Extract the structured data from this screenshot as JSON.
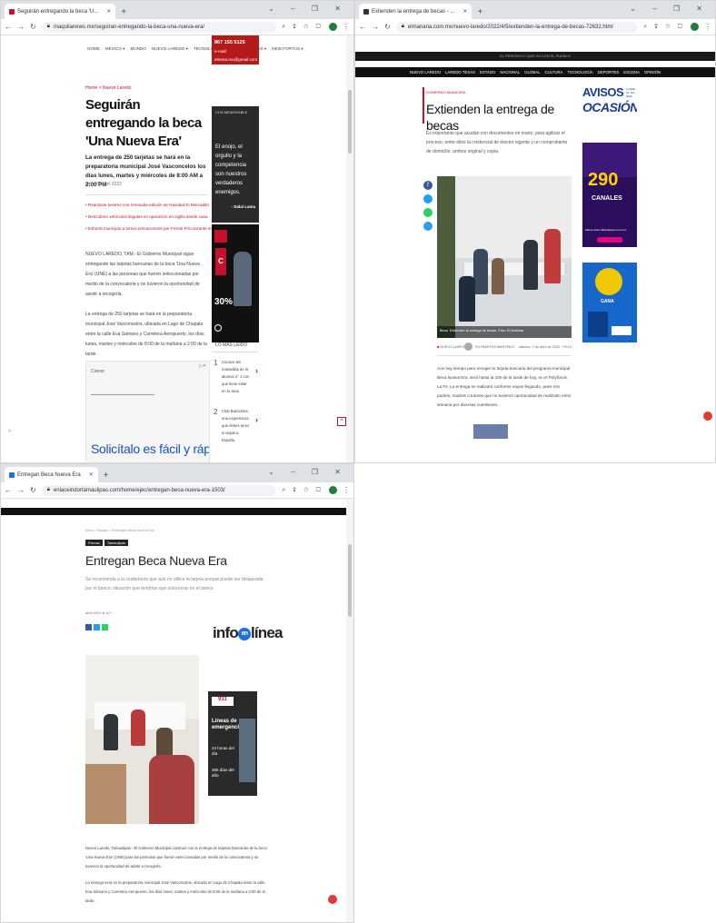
{
  "windows": {
    "w1": {
      "tab_title": "Seguirán entregando la beca 'U...",
      "url": "maquilanews.mx/seguiran-entregando-la-beca-una-nueva-era/",
      "nav_items": [
        "HOME",
        "MÉXICO ▾",
        "MUNDO",
        "NUEVO LAREDO ▾",
        "TECNOLOGÍA ▾",
        "ESPECTÁCULOS ▾",
        "NEW FORTUS ▾"
      ],
      "phone": "867 155 5125",
      "email": "e-mail: elmera.mx@gmail.com",
      "breadcrumb": "Home  >  Nuevo Laredo",
      "headline": "Seguirán entregando la beca 'Una Nueva Era'",
      "subhead": "La entrega de 250 tarjetas se hará en la preparatoria municipal José Vasconcelos los días lunes, martes y miércoles de 8:00 AM a 2:00 PM",
      "byline": "On  ·  25 abril 2022",
      "related": [
        "Reactivan turismo con renovada edición de Navidad El Mercadito",
        "Descubren vehículos ilegales en operación en vigilia desde casa",
        "Exhorta municipio a tomar precauciones por Frente Frío durante el fin de semana"
      ],
      "body1": "NUEVO LAREDO, TAM.- El Gobierno Municipal sigue entregando las tarjetas bancarias de la beca 'Una Nueva Era' (UNE) a las personas que fueron seleccionadas por medio de la convocatoria y no tuvieron la oportunidad de asistir a recogerla.",
      "body2": "La entrega de 250 tarjetas se hará en la preparatoria municipal José Vasconcelos, ubicada en Lago de Chapala entre la calle Eva Sámano y Carretera Aeropuerto, los días lunes, martes y miércoles de 8:00 de la mañana a 2:00 de la tarde.",
      "quote_label": "CITA MEMORABLE",
      "quote": "El enojo, el orgullo y la competencia son nuestros verdaderos enemigos.",
      "quote_author": "- Dalai Lama",
      "ad_percent": "30%",
      "most_read_label": "LO MÁS LEÍDO",
      "most_read": [
        {
          "num": "1",
          "text": "Conoce las maravillas de la alumna 4° 1 con que tiene estar en tu área"
        },
        {
          "num": "2",
          "text": "Club Barcelona, una experiencia que debes tener si viajas a España"
        }
      ],
      "ad_label": "Crecer",
      "ad_text": "Solicítalo es fácil y rápido"
    },
    "w2": {
      "tab_title": "Extienden la entrega de becas - ...",
      "url": "elmanana.com.mx/nuevo-laredo/2022/4/5/extienden-la-entrega-de-becas-72632.html",
      "top_strip": "EL PERIÓDICO QUE HA CON EL PUEBLO",
      "nav_items": [
        "NUEVO LAREDO",
        "LAREDO TEXAS",
        "ESTADO",
        "NACIONAL",
        "GLOBAL",
        "CULTURA",
        "TECNOLOGÍA",
        "DEPORTES",
        "ESCENA",
        "OPINIÓN"
      ],
      "kicker": "GOBIERNO MUNICIPAL",
      "headline": "Extienden la entrega de becas",
      "subhead": "Es importante que acudan con documentos en mano, para agilizar el proceso, entre ellos la credencial de elector vigente y un comprobante de domicilio, ambos original y copia.",
      "caption": "Beca. Extienden la entrega de becas. Foto: El Mañana",
      "section": "NUEVO LAREDO",
      "author": "Por MARTHA MARTÍNEZ",
      "date": "sábado, 2 de abril de 2022 · 09:10",
      "body": "Aún hay tiempo para recoger tu tarjeta bancaria del programa municipal Beca Nueva Era, será hasta la 100 de la tarde de hoy, en el Polyforum La Fe. La entrega se realizará conforme vayan llegando, pues son padres, madres o tutores que no tuvieron oportunidad de realizarlo entre semana por diversas cuestiones.",
      "avisos_line1": "AVISOS",
      "avisos_line2": "OCASIÓN",
      "avisos_side": "LLAME AL 711-9000",
      "ad1_big": "290",
      "ad1_label": "CANALES",
      "ad1_url": "Marca www.cablecalepco.com.mx",
      "ad2_label": "GANA"
    },
    "w3": {
      "tab_title": "Entregan Beca Nueva Era",
      "url": "enlaceindortamaulipas.com/home/ejec/entregan-beca-nueva-era-1503/",
      "breadcrumb": "Inicio  ›  Estado  ›  Entregan Beca Nueva Era",
      "tags": [
        "Prensa",
        "Tamaulipas"
      ],
      "headline": "Entregan Beca Nueva Era",
      "subhead": "Se recomienda a la ciudadanía que aún no utilice la tarjeta porque puede ser bloqueada por el banco; situación que tendrían que solucionar en el banco",
      "meta": "abril 2022   ● 127",
      "logo_text1": "info",
      "logo_text2": "en",
      "logo_text3": "línea",
      "ad_title": "Líneas de emergencia",
      "ad_lines": [
        "24 horas del día",
        "365 días del año"
      ],
      "body1": "Nuevo Laredo, Tamaulipas.- El Gobierno Municipal continuó con la entrega de tarjetas bancarias de la beca 'Una Nueva Era' (UNE) para las personas que fueron seleccionadas por medio de la convocatoria y no tuvieron la oportunidad de asistir a recogerla.",
      "body2": "La entrega será en la preparatoria municipal José Vasconcelos, ubicada en Lago de Chapala entre la calle Eva Sámano y Carretera Aeropuerto, los días lunes, martes y miércoles de 8:00 de la mañana a 2:00 de la tarde."
    }
  },
  "colors": {
    "accent_red": "#c8102e",
    "nav_black": "#111111",
    "fb_blue": "#3b5998",
    "tw_blue": "#1da1f2",
    "wa_green": "#25d366"
  }
}
